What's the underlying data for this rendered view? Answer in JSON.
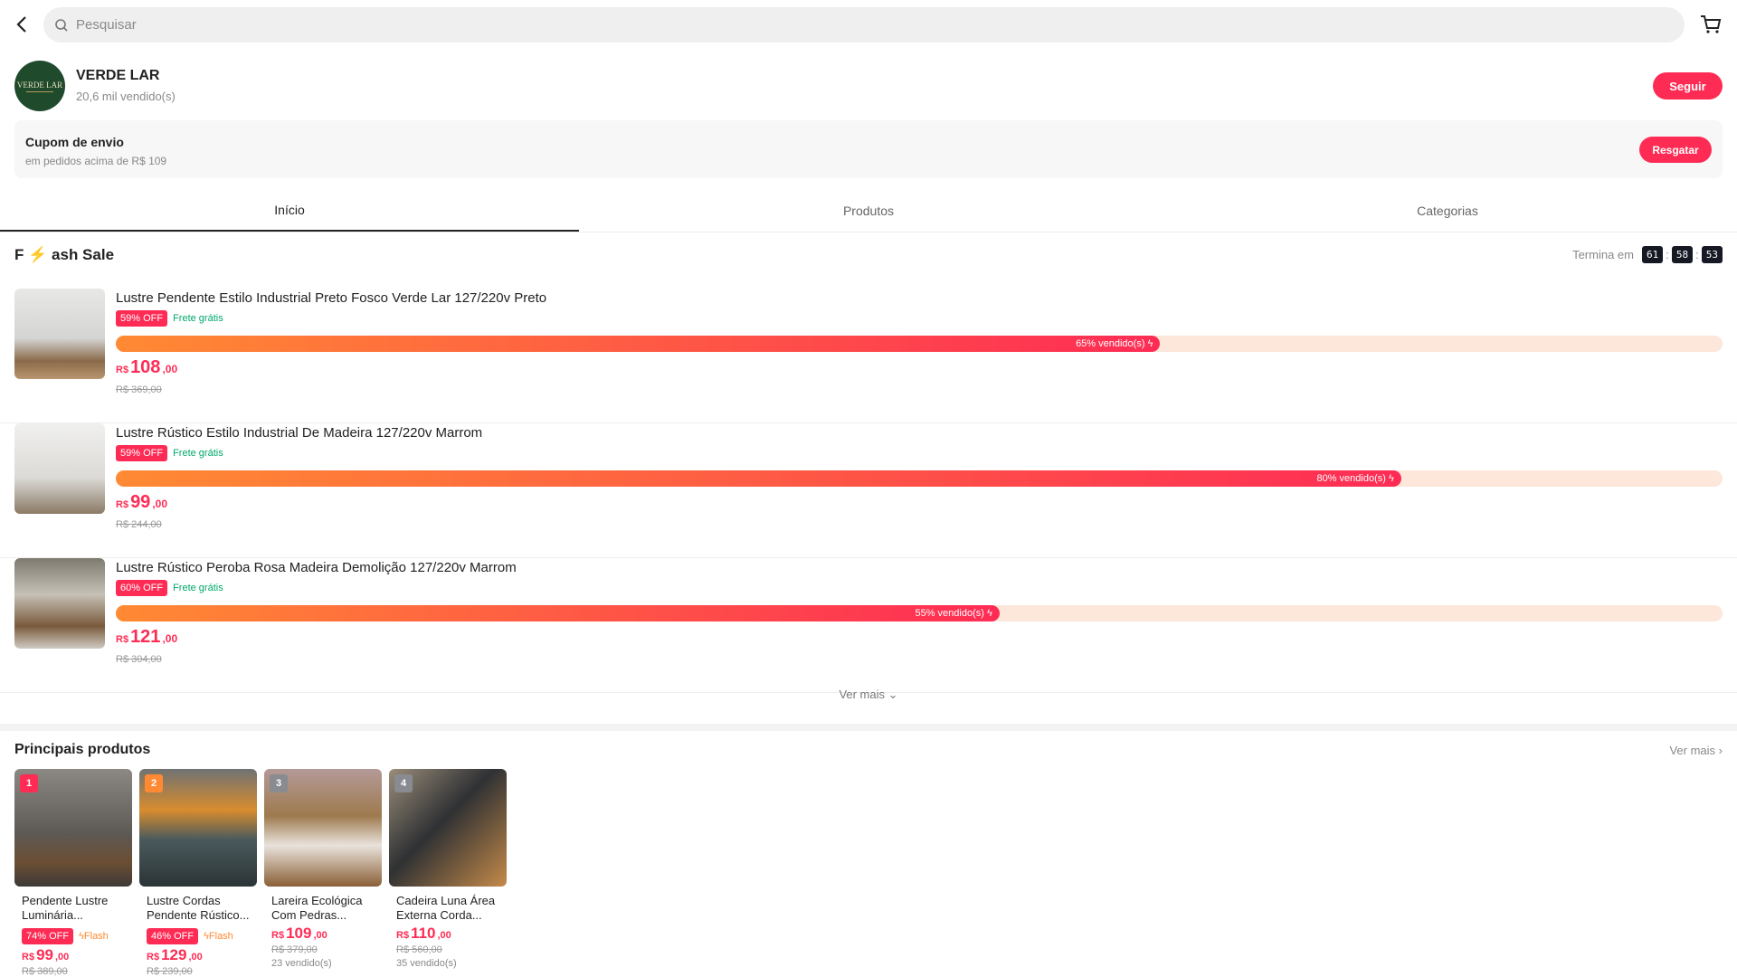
{
  "search": {
    "placeholder": "Pesquisar"
  },
  "shop": {
    "name": "VERDE LAR",
    "logo_text": "VERDE LAR",
    "sold": "20,6 mil vendido(s)",
    "follow": "Seguir"
  },
  "coupon": {
    "title": "Cupom de envio",
    "subtitle": "em pedidos acima de R$ 109",
    "button": "Resgatar"
  },
  "tabs": [
    {
      "label": "Início",
      "active": true
    },
    {
      "label": "Produtos"
    },
    {
      "label": "Categorias"
    }
  ],
  "flash": {
    "title_a": "F",
    "title_b": "ash Sale",
    "ends_label": "Termina em",
    "hh": "61",
    "mm": "58",
    "ss": "53",
    "items": [
      {
        "title": "Lustre Pendente Estilo Industrial Preto Fosco Verde Lar 127/220v Preto",
        "off": "59% OFF",
        "shipping": "Frete grátis",
        "sold_pct": 65,
        "sold_label": "65% vendido(s)",
        "currency": "R$",
        "price_int": "108",
        "price_dec": ",00",
        "old_price": "R$ 369,00"
      },
      {
        "title": "Lustre Rústico Estilo Industrial De Madeira 127/220v Marrom",
        "off": "59% OFF",
        "shipping": "Frete grátis",
        "sold_pct": 80,
        "sold_label": "80% vendido(s)",
        "currency": "R$",
        "price_int": "99",
        "price_dec": ",00",
        "old_price": "R$ 244,00"
      },
      {
        "title": "Lustre Rústico Peroba Rosa Madeira Demolição 127/220v Marrom",
        "off": "60% OFF",
        "shipping": "Frete grátis",
        "sold_pct": 55,
        "sold_label": "55% vendido(s)",
        "currency": "R$",
        "price_int": "121",
        "price_dec": ",00",
        "old_price": "R$ 304,00"
      }
    ],
    "more": "Ver mais"
  },
  "top": {
    "title": "Principais produtos",
    "more": "Ver mais",
    "items": [
      {
        "rank": "1",
        "name": "Pendente Lustre Luminária...",
        "off": "74% OFF",
        "flash": "Flash",
        "currency": "R$",
        "price_int": "99",
        "price_dec": ",00",
        "old_price": "R$ 389,00",
        "sold": ""
      },
      {
        "rank": "2",
        "name": "Lustre Cordas Pendente Rústico...",
        "off": "46% OFF",
        "flash": "Flash",
        "currency": "R$",
        "price_int": "129",
        "price_dec": ",00",
        "old_price": "R$ 239,00",
        "sold": ""
      },
      {
        "rank": "3",
        "name": "Lareira Ecológica Com Pedras...",
        "currency": "R$",
        "price_int": "109",
        "price_dec": ",00",
        "old_price": "R$ 379,00",
        "sold": "23 vendido(s)"
      },
      {
        "rank": "4",
        "name": "Cadeira Luna Área Externa Corda...",
        "currency": "R$",
        "price_int": "110",
        "price_dec": ",00",
        "old_price": "R$ 560,00",
        "sold": "35 vendido(s)"
      }
    ]
  },
  "colors": {
    "accent": "#fe2c55",
    "orange": "#ff8a33",
    "green": "#00a86b"
  }
}
